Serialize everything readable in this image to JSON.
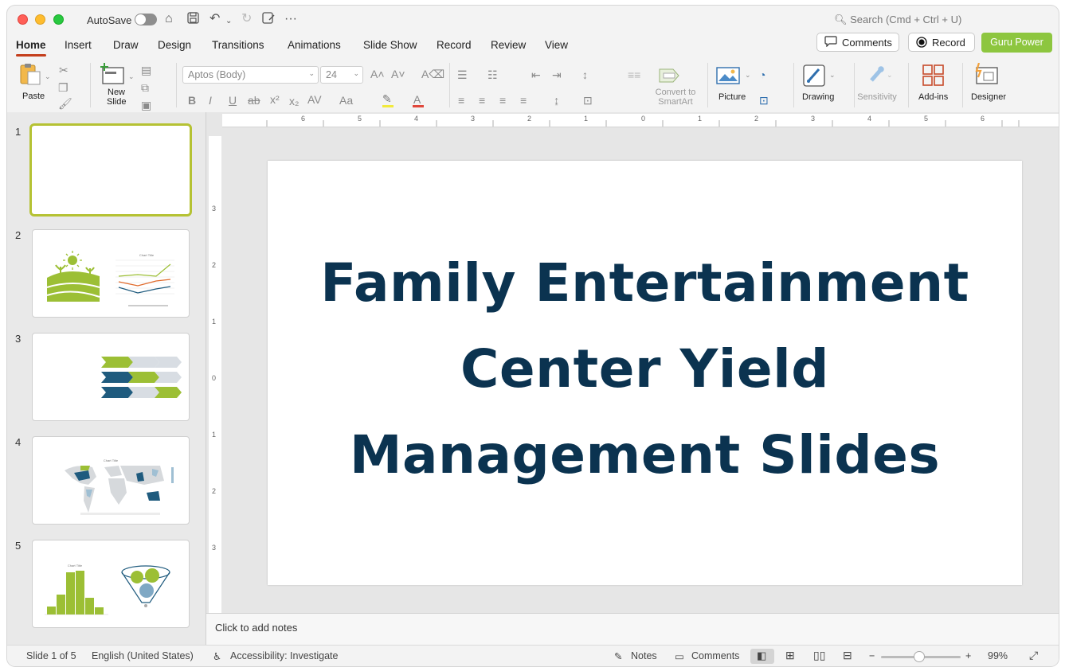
{
  "titlebar": {
    "autosave_label": "AutoSave",
    "search_placeholder": "Search (Cmd + Ctrl + U)"
  },
  "tabs": [
    "Home",
    "Insert",
    "Draw",
    "Design",
    "Transitions",
    "Animations",
    "Slide Show",
    "Record",
    "Review",
    "View"
  ],
  "tab_actions": {
    "comments": "Comments",
    "record": "Record",
    "guru": "Guru Power"
  },
  "ribbon": {
    "paste": "Paste",
    "new_slide_1": "New",
    "new_slide_2": "Slide",
    "font_name": "Aptos (Body)",
    "font_size": "24",
    "convert_1": "Convert to",
    "convert_2": "SmartArt",
    "picture": "Picture",
    "drawing": "Drawing",
    "sensitivity": "Sensitivity",
    "addins": "Add-ins",
    "designer": "Designer"
  },
  "thumbnails": [
    "1",
    "2",
    "3",
    "4",
    "5"
  ],
  "thumb_chart_titles": {
    "t2": "Chart Title",
    "t4": "Chart Title",
    "t5": "Chart Title"
  },
  "ruler_h": [
    "6",
    "5",
    "4",
    "3",
    "2",
    "1",
    "0",
    "1",
    "2",
    "3",
    "4",
    "5",
    "6"
  ],
  "ruler_v": [
    "3",
    "2",
    "1",
    "0",
    "1",
    "2",
    "3"
  ],
  "slide": {
    "title_line1": "Family Entertainment",
    "title_line2": "Center Yield",
    "title_line3": "Management Slides"
  },
  "notes_placeholder": "Click to add notes",
  "status": {
    "slide_of": "Slide 1 of 5",
    "language": "English (United States)",
    "accessibility": "Accessibility: Investigate",
    "notes": "Notes",
    "comments": "Comments",
    "zoom": "99%"
  },
  "colors": {
    "accent_tab": "#c43e1c",
    "guru_green": "#8dc63f",
    "title_navy": "#0b3350",
    "thumb_green": "#9cbf35",
    "thumb_blue": "#1f5b7e"
  }
}
